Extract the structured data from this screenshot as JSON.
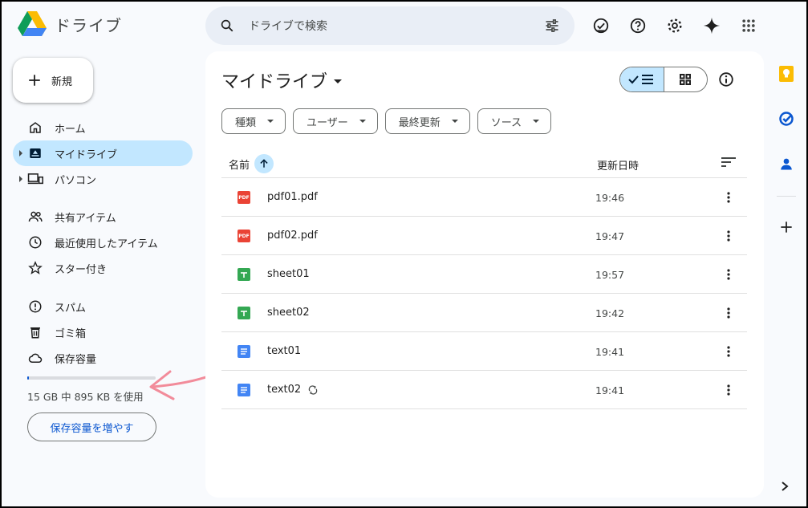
{
  "app": {
    "logo_text": "ドライブ"
  },
  "search": {
    "placeholder": "ドライブで検索"
  },
  "sidebar": {
    "new_label": "新規",
    "items": [
      {
        "label": "ホーム"
      },
      {
        "label": "マイドライブ"
      },
      {
        "label": "パソコン"
      },
      {
        "label": "共有アイテム"
      },
      {
        "label": "最近使用したアイテム"
      },
      {
        "label": "スター付き"
      },
      {
        "label": "スパム"
      },
      {
        "label": "ゴミ箱"
      },
      {
        "label": "保存容量"
      }
    ],
    "storage_text": "15 GB 中 895 KB を使用",
    "more_storage_label": "保存容量を増やす"
  },
  "main": {
    "title": "マイドライブ",
    "filters": [
      "種類",
      "ユーザー",
      "最終更新",
      "ソース"
    ],
    "columns": {
      "name": "名前",
      "modified": "更新日時"
    },
    "files": [
      {
        "name": "pdf01.pdf",
        "type": "pdf",
        "time": "19:46"
      },
      {
        "name": "pdf02.pdf",
        "type": "pdf",
        "time": "19:47"
      },
      {
        "name": "sheet01",
        "type": "sheet",
        "time": "19:57"
      },
      {
        "name": "sheet02",
        "type": "sheet",
        "time": "19:42"
      },
      {
        "name": "text01",
        "type": "doc",
        "time": "19:41"
      },
      {
        "name": "text02",
        "type": "doc",
        "time": "19:41",
        "syncing": true
      }
    ],
    "pdf_badge": "PDF"
  },
  "colors": {
    "accent": "#0b57d0",
    "active_bg": "#c2e7ff",
    "pdf": "#ea4335",
    "sheet": "#34a853",
    "doc": "#4285f4",
    "keep": "#fbbc04",
    "annotation_arrow": "#f28b9a"
  },
  "icons": {
    "header": [
      "search-icon",
      "search-options-icon",
      "offline-ready-icon",
      "help-icon",
      "settings-icon",
      "gemini-icon",
      "apps-grid-icon"
    ],
    "rail": [
      "keep-icon",
      "tasks-icon",
      "contacts-icon",
      "add-icon",
      "expand-icon"
    ]
  }
}
